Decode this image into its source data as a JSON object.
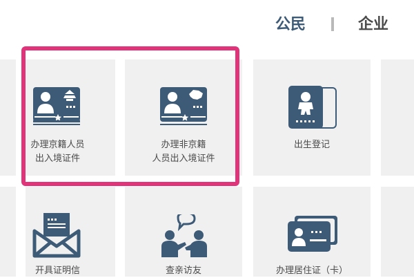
{
  "tabs": {
    "citizen": "公民",
    "enterprise": "企业"
  },
  "services": {
    "beijing_exit_entry": [
      "办理京籍人员",
      "出入境证件"
    ],
    "non_beijing_exit_entry": [
      "办理非京籍",
      "人员出入境证件"
    ],
    "birth_registration": [
      "出生登记"
    ],
    "certificate": [
      "开具证明信"
    ],
    "visit_relatives": [
      "查亲访友"
    ],
    "residence_permit": [
      "办理居住证（卡）"
    ]
  },
  "colors": {
    "icon": "#3d5a76",
    "tile": "#f0f0f0",
    "highlight": "#e0337a"
  }
}
